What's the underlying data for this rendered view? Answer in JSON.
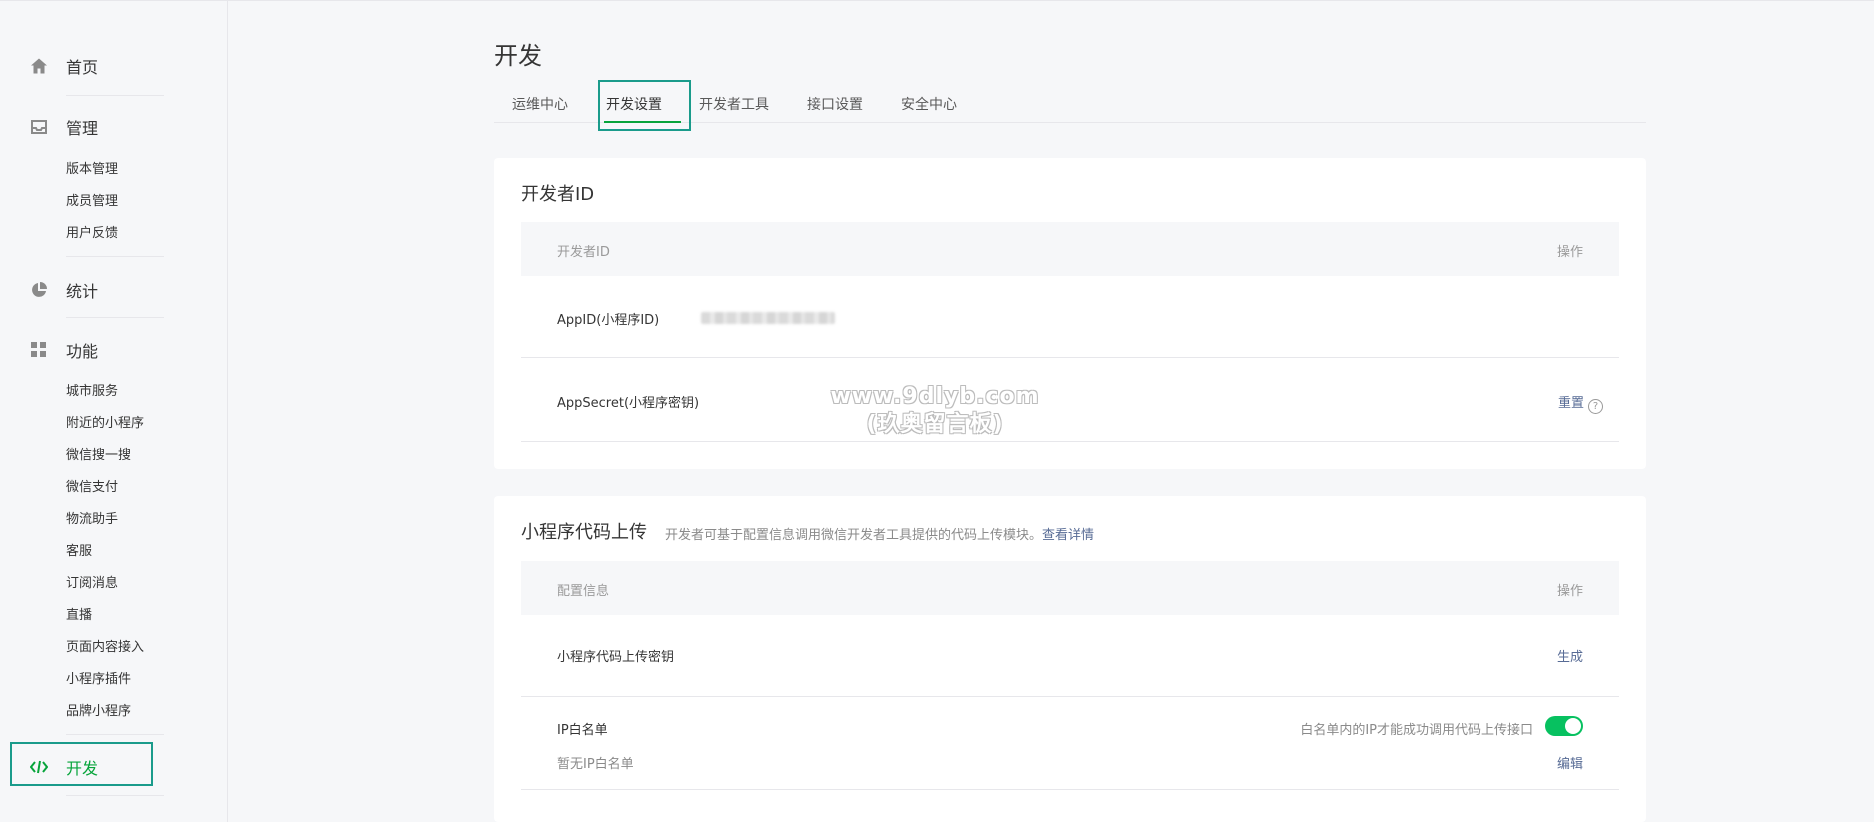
{
  "sidebar": {
    "home": {
      "label": "首页",
      "icon": "home-icon"
    },
    "manage": {
      "label": "管理",
      "icon": "inbox-icon",
      "items": [
        "版本管理",
        "成员管理",
        "用户反馈"
      ]
    },
    "stats": {
      "label": "统计",
      "icon": "pie-chart-icon"
    },
    "features": {
      "label": "功能",
      "icon": "grid-icon",
      "items": [
        "城市服务",
        "附近的小程序",
        "微信搜一搜",
        "微信支付",
        "物流助手",
        "客服",
        "订阅消息",
        "直播",
        "页面内容接入",
        "小程序插件",
        "品牌小程序"
      ]
    },
    "develop": {
      "label": "开发",
      "icon": "code-icon"
    },
    "accent_color": "#07a43b"
  },
  "page": {
    "title": "开发",
    "tabs": [
      "运维中心",
      "开发设置",
      "开发者工具",
      "接口设置",
      "安全中心"
    ],
    "active_tab": "开发设置"
  },
  "dev_id_card": {
    "title": "开发者ID",
    "col_left": "开发者ID",
    "col_right": "操作",
    "rows": [
      {
        "label": "AppID(小程序ID)",
        "value_masked": true
      },
      {
        "label": "AppSecret(小程序密钥)",
        "action": "重置"
      }
    ]
  },
  "upload_card": {
    "title": "小程序代码上传",
    "desc": "开发者可基于配置信息调用微信开发者工具提供的代码上传模块。",
    "desc_link": "查看详情",
    "col_left": "配置信息",
    "col_right": "操作",
    "key_row": {
      "label": "小程序代码上传密钥",
      "action": "生成"
    },
    "ip_row": {
      "label": "IP白名单",
      "sub": "暂无IP白名单",
      "hint": "白名单内的IP才能成功调用代码上传接口",
      "toggle_on": true,
      "action": "编辑"
    }
  },
  "watermark": {
    "line1": "www.9dlyb.com",
    "line2": "(玖奥留言板)"
  },
  "colors": {
    "green": "#07a43b",
    "link": "#576b95",
    "highlight_box": "#1a9b8b",
    "toggle": "#07c160"
  }
}
